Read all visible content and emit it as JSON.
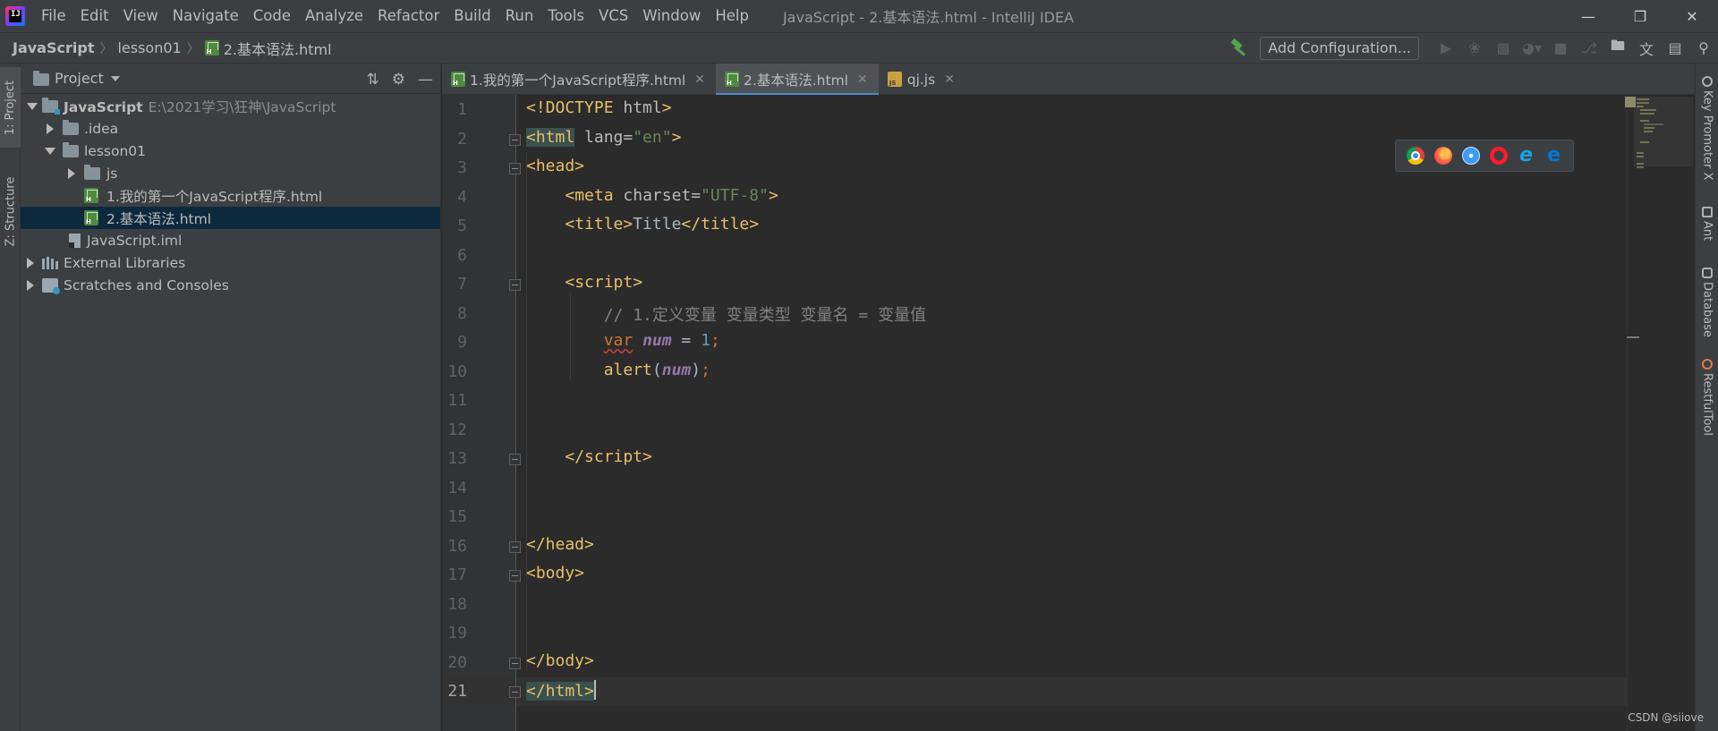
{
  "menubar": {
    "items": [
      "File",
      "Edit",
      "View",
      "Navigate",
      "Code",
      "Analyze",
      "Refactor",
      "Build",
      "Run",
      "Tools",
      "VCS",
      "Window",
      "Help"
    ],
    "window_title": "JavaScript - 2.基本语法.html - IntelliJ IDEA"
  },
  "breadcrumb": {
    "project": "JavaScript",
    "folder": "lesson01",
    "file": "2.基本语法.html"
  },
  "toolbar": {
    "add_config_label": "Add Configuration..."
  },
  "left_strip": {
    "project_tab": "1: Project",
    "structure_tab": "Z: Structure"
  },
  "project_panel": {
    "title": "Project",
    "tree": [
      {
        "label": "JavaScript",
        "hint": "E:\\2021学习\\狂神\\JavaScript"
      },
      {
        "label": ".idea"
      },
      {
        "label": "lesson01"
      },
      {
        "label": "js"
      },
      {
        "label": "1.我的第一个JavaScript程序.html"
      },
      {
        "label": "2.基本语法.html"
      },
      {
        "label": "JavaScript.iml"
      },
      {
        "label": "External Libraries"
      },
      {
        "label": "Scratches and Consoles"
      }
    ]
  },
  "editor_tabs": [
    {
      "label": "1.我的第一个JavaScript程序.html",
      "active": false
    },
    {
      "label": "2.基本语法.html",
      "active": true
    },
    {
      "label": "qj.js",
      "active": false
    }
  ],
  "code": {
    "line_numbers": [
      "1",
      "2",
      "3",
      "4",
      "5",
      "6",
      "7",
      "8",
      "9",
      "10",
      "11",
      "12",
      "13",
      "14",
      "15",
      "16",
      "17",
      "18",
      "19",
      "20",
      "21"
    ],
    "current_line": 21,
    "comment_text": "// 1.定义变量 变量类型 变量名 = 变量值"
  },
  "right_strip": {
    "tabs": [
      "Key Promoter X",
      "Ant",
      "Database",
      "RestfulTool"
    ]
  },
  "watermark": "CSDN @siiove",
  "colors": {
    "background": "#2b2b2b",
    "panel": "#3c3f41",
    "selection": "#0d293e",
    "tab_underline": "#4a88c7",
    "tag": "#e8bf6a",
    "string": "#6a8759",
    "keyword": "#cc7832",
    "number": "#6897bb",
    "comment": "#808080",
    "identifier": "#9876aa"
  }
}
